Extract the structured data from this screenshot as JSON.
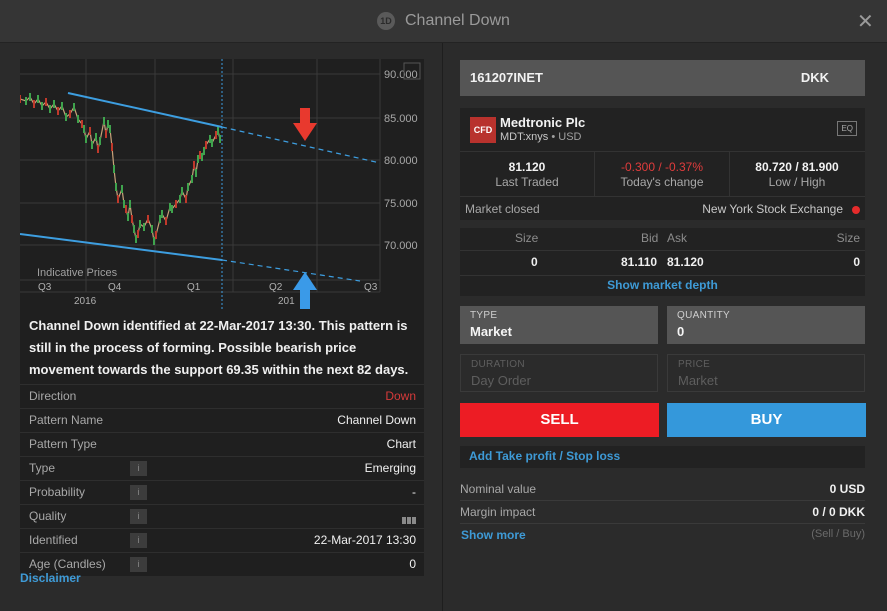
{
  "window": {
    "badge": "1D",
    "title": "Channel Down",
    "close_label": "✕"
  },
  "chart": {
    "y_ticks": [
      "90.000",
      "85.000",
      "80.000",
      "75.000",
      "70.000"
    ],
    "x_ticks": [
      "Q3",
      "Q4",
      "Q1",
      "Q2",
      "Q3"
    ],
    "years": [
      "2016",
      "201"
    ],
    "watermark": "Indicative Prices",
    "arrow_down_color": "#e8392e",
    "arrow_up_color": "#3a9ae8",
    "channel_color": "#3d9ee0"
  },
  "pattern": {
    "description": "Channel Down identified at 22-Mar-2017 13:30. This pattern is still in the process of forming. Possible bearish price movement towards the support 69.35 within the next 82 days.",
    "rows": [
      {
        "label": "Direction",
        "value": "Down",
        "info": false
      },
      {
        "label": "Pattern Name",
        "value": "Channel Down",
        "info": false
      },
      {
        "label": "Pattern Type",
        "value": "Chart",
        "info": false
      },
      {
        "label": "Type",
        "value": "Emerging",
        "info": true
      },
      {
        "label": "Probability",
        "value": "-",
        "info": true
      },
      {
        "label": "Quality",
        "value": "",
        "info": true
      },
      {
        "label": "Identified",
        "value": "22-Mar-2017 13:30",
        "info": true
      },
      {
        "label": "Age (Candles)",
        "value": "0",
        "info": true
      }
    ],
    "info_glyph": "i",
    "disclaimer": "Disclaimer"
  },
  "account": {
    "id": "161207INET",
    "currency": "DKK"
  },
  "instrument": {
    "badge": "CFD",
    "name": "Medtronic Plc",
    "symbol": "MDT:xnys",
    "currency": "USD",
    "type_tag": "EQ",
    "last_traded": "81.120",
    "last_traded_label": "Last Traded",
    "change": "-0.300 / -0.37%",
    "change_label": "Today's change",
    "low_high": "80.720 / 81.900",
    "low_high_label": "Low / High",
    "market_status": "Market closed",
    "exchange": "New York Stock Exchange"
  },
  "depth": {
    "headers": {
      "size_left": "Size",
      "bid": "Bid",
      "ask": "Ask",
      "size_right": "Size"
    },
    "row": {
      "bid_size": "0",
      "bid": "81.110",
      "ask": "81.120",
      "ask_size": "0"
    },
    "link": "Show market depth"
  },
  "order": {
    "type_label": "TYPE",
    "type_value": "Market",
    "quantity_label": "QUANTITY",
    "quantity_value": "0",
    "duration_label": "DURATION",
    "duration_value": "Day Order",
    "price_label": "PRICE",
    "price_value": "Market",
    "sell": "SELL",
    "buy": "BUY",
    "take_profit": "Add Take profit / Stop loss",
    "nominal_label": "Nominal value",
    "nominal_value": "0  USD",
    "margin_label": "Margin impact",
    "margin_value": "0 / 0  DKK",
    "show_more": "Show more",
    "sell_buy_hint": "(Sell / Buy)"
  }
}
